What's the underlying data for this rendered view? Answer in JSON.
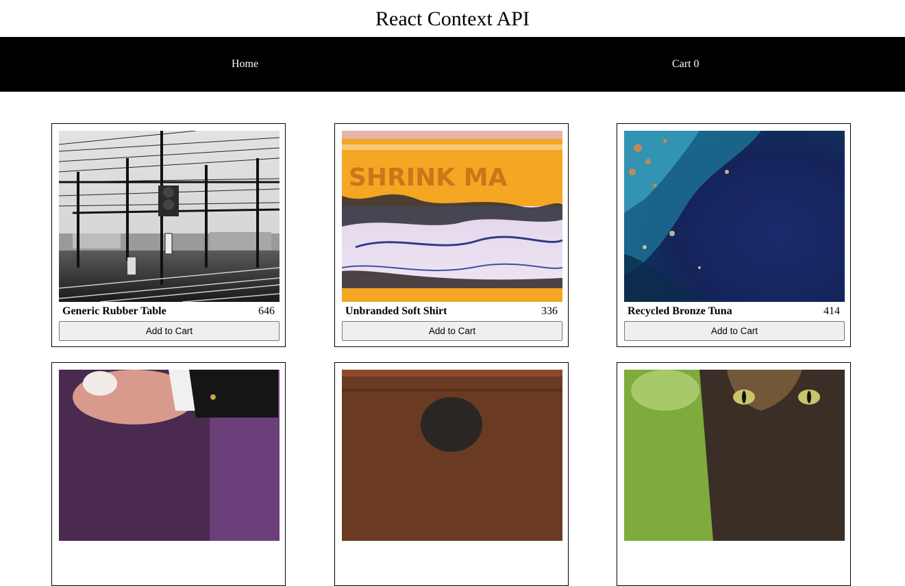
{
  "header": {
    "title": "React Context API"
  },
  "nav": {
    "home_label": "Home",
    "cart_label": "Cart",
    "cart_count": "0"
  },
  "products": [
    {
      "name": "Generic Rubber Table",
      "price": "646",
      "button_label": "Add to Cart",
      "image": "railway-overhead-lines-bw-photo"
    },
    {
      "name": "Unbranded Soft Shirt",
      "price": "336",
      "button_label": "Add to Cart",
      "image": "blurred-orange-sign-photo"
    },
    {
      "name": "Recycled Bronze Tuna",
      "price": "414",
      "button_label": "Add to Cart",
      "image": "blue-abstract-texture-photo"
    },
    {
      "image": "kitten-with-hand-photo"
    },
    {
      "image": "wooden-wall-photo"
    },
    {
      "image": "cat-green-eyes-photo"
    }
  ]
}
